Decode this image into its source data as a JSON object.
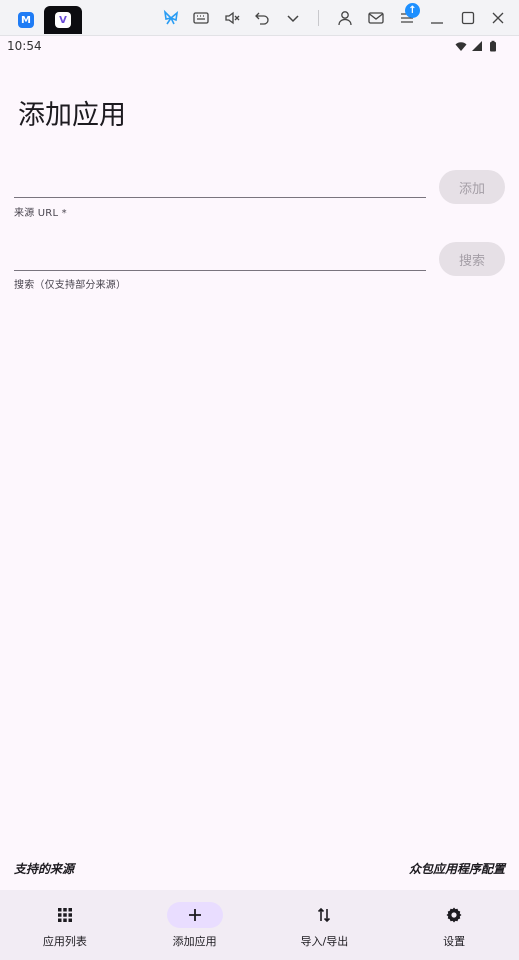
{
  "chrome": {
    "tabs": [
      {
        "icon": "app-m-icon",
        "badge": "M"
      },
      {
        "icon": "app-v-icon",
        "badge": "V"
      }
    ],
    "notification_count": "↑"
  },
  "status_bar": {
    "time": "10:54"
  },
  "page": {
    "title": "添加应用",
    "source_url": {
      "value": "",
      "label": "来源 URL *",
      "button": "添加"
    },
    "search": {
      "value": "",
      "label": "搜索（仅支持部分来源）",
      "button": "搜索"
    },
    "footer": {
      "supported_sources": "支持的来源",
      "crowdsourced_config": "众包应用程序配置"
    }
  },
  "bottom_nav": {
    "items": [
      {
        "label": "应用列表",
        "icon": "grid-icon",
        "active": false
      },
      {
        "label": "添加应用",
        "icon": "plus-icon",
        "active": true
      },
      {
        "label": "导入/导出",
        "icon": "import-export-icon",
        "active": false
      },
      {
        "label": "设置",
        "icon": "gear-icon",
        "active": false
      }
    ]
  },
  "colors": {
    "background": "#fdf7fd",
    "nav_background": "#f2ecf4",
    "active_indicator": "#e9ddff",
    "disabled_button": "#e6e0e6"
  }
}
